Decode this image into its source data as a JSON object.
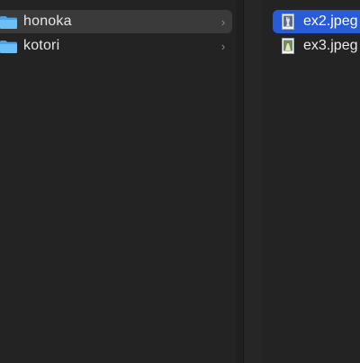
{
  "columns": {
    "folders": [
      {
        "label": "honoka",
        "icon": "folder-icon",
        "state": "selected-inactive",
        "chevron": "›"
      },
      {
        "label": "kotori",
        "icon": "folder-icon",
        "state": "normal",
        "chevron": "›"
      }
    ],
    "files": [
      {
        "label": "ex2.jpeg",
        "icon": "jpeg-file-icon",
        "state": "selected-active"
      },
      {
        "label": "ex3.jpeg",
        "icon": "jpeg-file-icon",
        "state": "normal"
      }
    ]
  },
  "colors": {
    "background": "#232323",
    "selection_active": "#2a5bd7",
    "selection_inactive": "#3a3a3a",
    "folder": "#5eb3f0",
    "text": "#e6e6e6"
  }
}
